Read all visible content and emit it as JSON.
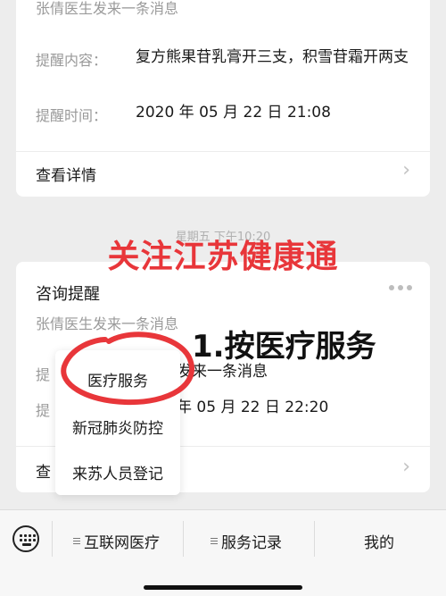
{
  "card1": {
    "subtitle": "张倩医生发来一条消息",
    "reminder_label": "提醒内容：",
    "reminder_value": "复方熊果苷乳膏开三支，积雪苷霜开两支",
    "time_label": "提醒时间：",
    "time_value": "2020 年 05 月 22 日 21:08",
    "detail_label": "查看详情"
  },
  "timestamp": "星期五 下午10:20",
  "overlay": {
    "headline": "关注江苏健康通",
    "step": "1.按医疗服务",
    "circle_color": "#e8363a"
  },
  "card2": {
    "title": "咨询提醒",
    "subtitle": "张倩医生发来一条消息",
    "reminder_label": "提",
    "reminder_value": "发来一条消息",
    "time_label": "提",
    "time_value": "年 05 月 22 日 22:20",
    "detail_label": "查"
  },
  "popup": {
    "items": [
      "医疗服务",
      "新冠肺炎防控",
      "来苏人员登记"
    ]
  },
  "bottombar": {
    "menu1": "互联网医疗",
    "menu2": "服务记录",
    "menu3": "我的"
  }
}
